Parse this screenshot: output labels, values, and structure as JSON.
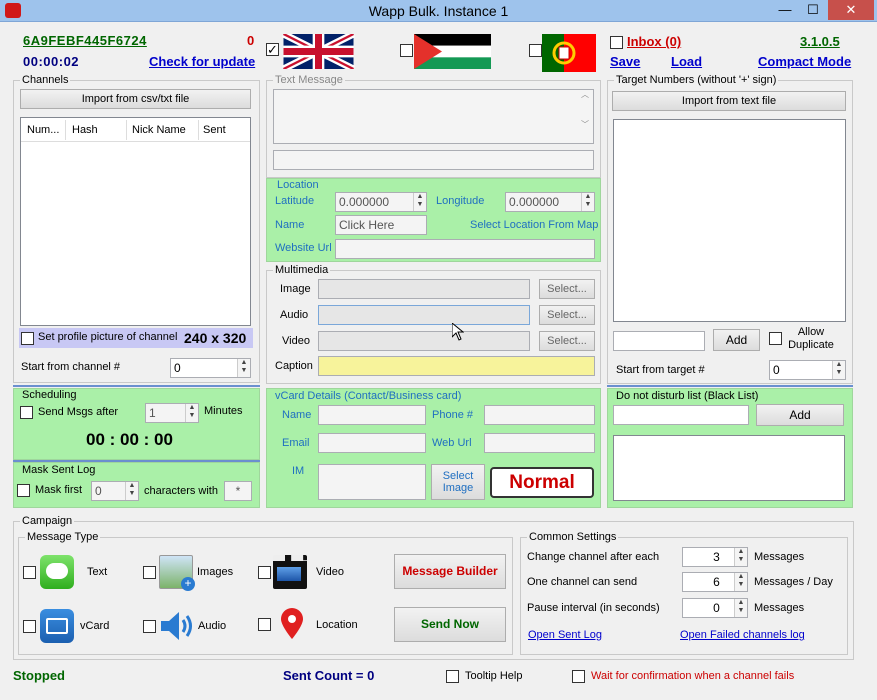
{
  "window": {
    "title": "Wapp Bulk. Instance 1",
    "min": "—",
    "max": "☐",
    "close": "✕"
  },
  "header": {
    "license": "6A9FEBF445F6724",
    "counter": "0",
    "timer": "00:00:02",
    "check_update": "Check for update",
    "inbox": "Inbox (0)",
    "version": "3.1.0.5",
    "save": "Save",
    "load": "Load",
    "compact": "Compact Mode"
  },
  "channels": {
    "legend": "Channels",
    "import": "Import from csv/txt file",
    "columns": [
      "Num...",
      "Hash",
      "Nick Name",
      "Sent"
    ],
    "set_profile": "Set profile picture of channel",
    "size": "240 x 320",
    "start_from": "Start from channel #",
    "start_value": "0"
  },
  "text_message": {
    "legend": "Text Message"
  },
  "location": {
    "legend": "Location",
    "latitude_label": "Latitude",
    "latitude": "0.000000",
    "longitude_label": "Longitude",
    "longitude": "0.000000",
    "name_label": "Name",
    "name_value": "Click Here",
    "select_map": "Select Location From Map",
    "website_label": "Website Url"
  },
  "multimedia": {
    "legend": "Multimedia",
    "image": "Image",
    "audio": "Audio",
    "video": "Video",
    "caption": "Caption",
    "select": "Select..."
  },
  "targets": {
    "legend": "Target Numbers (without '+' sign)",
    "import": "Import from text file",
    "add": "Add",
    "allow_dup": "Allow Duplicate",
    "start_from": "Start from target #",
    "start_value": "0"
  },
  "scheduling": {
    "legend": "Scheduling",
    "send_after": "Send Msgs after",
    "minutes_value": "1",
    "minutes": "Minutes",
    "clock": "00 : 00 : 00"
  },
  "mask": {
    "legend": "Mask Sent Log",
    "mask_first": "Mask first",
    "value": "0",
    "chars_with": "characters with",
    "symbol": "*"
  },
  "vcard": {
    "legend": "vCard Details (Contact/Business card)",
    "name": "Name",
    "phone": "Phone #",
    "email": "Email",
    "weburl": "Web Url",
    "im": "IM",
    "select_image": "Select Image",
    "mode": "Normal"
  },
  "blacklist": {
    "legend": "Do not disturb list (Black List)",
    "add": "Add"
  },
  "campaign": {
    "legend": "Campaign",
    "message_type_legend": "Message Type",
    "types": [
      "Text",
      "Images",
      "Video",
      "vCard",
      "Audio",
      "Location"
    ],
    "message_builder": "Message Builder",
    "send_now": "Send Now"
  },
  "common": {
    "legend": "Common Settings",
    "change_after": "Change channel after each",
    "change_value": "3",
    "change_unit": "Messages",
    "can_send": "One channel can send",
    "can_value": "6",
    "can_unit": "Messages / Day",
    "pause": "Pause interval (in seconds)",
    "pause_value": "0",
    "pause_unit": "Messages",
    "open_sent": "Open Sent Log",
    "open_failed": "Open Failed channels log"
  },
  "status": {
    "state": "Stopped",
    "sent_count": "Sent Count = 0",
    "tooltip": "Tooltip Help",
    "wait_confirm": "Wait for confirmation when a channel fails"
  },
  "colors": {
    "green_panel": "#aaf0a8",
    "link": "#0000cc",
    "license": "#006600",
    "red": "#cc0000",
    "lavender": "#c8c8f4"
  }
}
